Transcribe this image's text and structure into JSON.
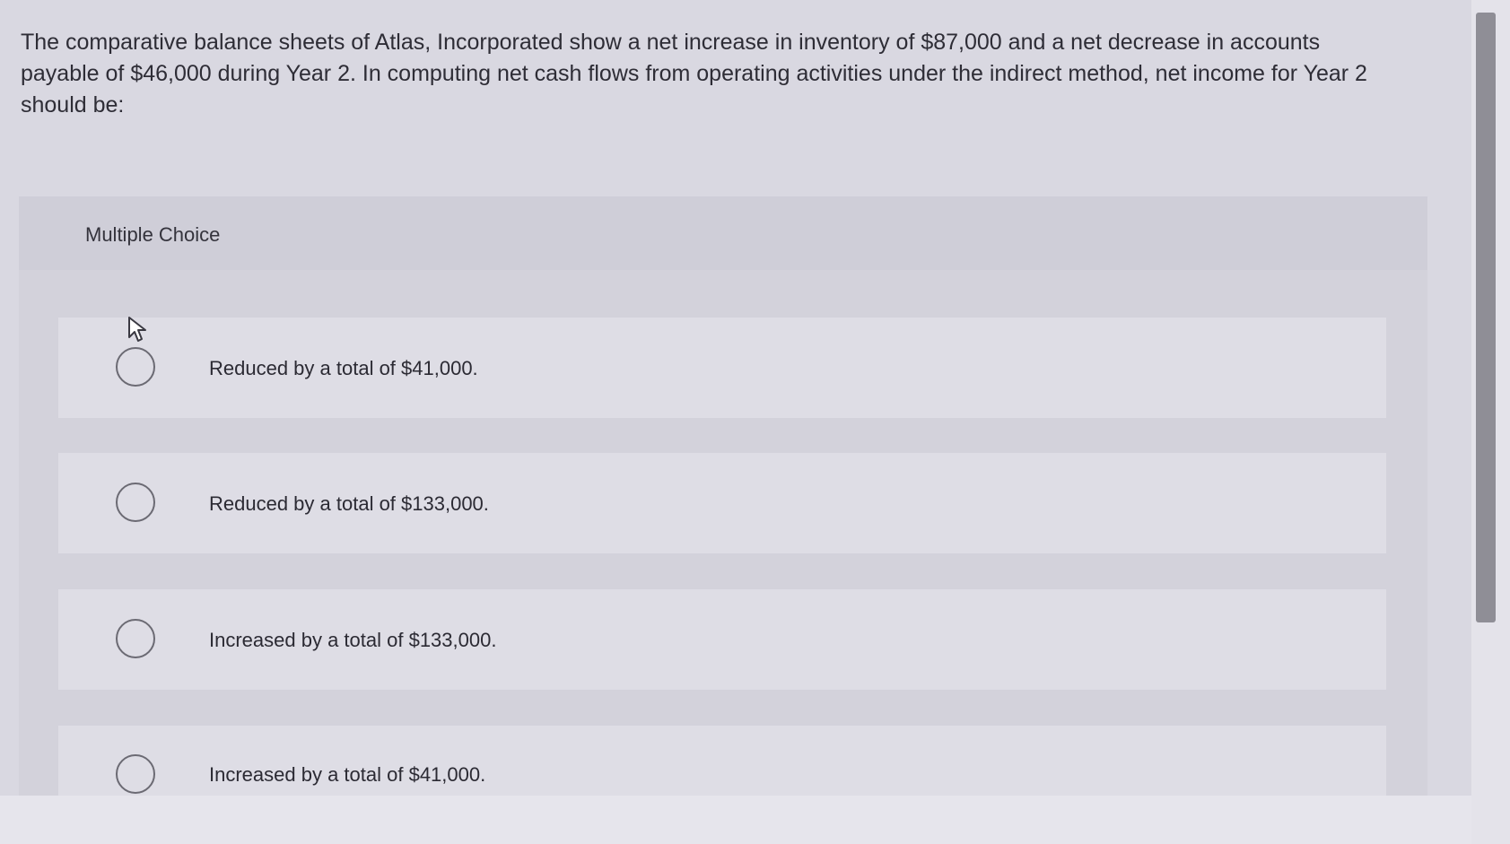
{
  "question": {
    "text": "The comparative balance sheets of Atlas, Incorporated show a net increase in inventory of $87,000 and a net decrease in accounts payable of $46,000 during Year 2. In computing net cash flows from operating activities under the indirect method, net income for Year 2 should be:"
  },
  "multiple_choice": {
    "title": "Multiple Choice",
    "options": [
      {
        "label": "Reduced by a total of $41,000."
      },
      {
        "label": "Reduced by a total of $133,000."
      },
      {
        "label": "Increased by a total of $133,000."
      },
      {
        "label": "Increased by a total of $41,000."
      }
    ]
  }
}
